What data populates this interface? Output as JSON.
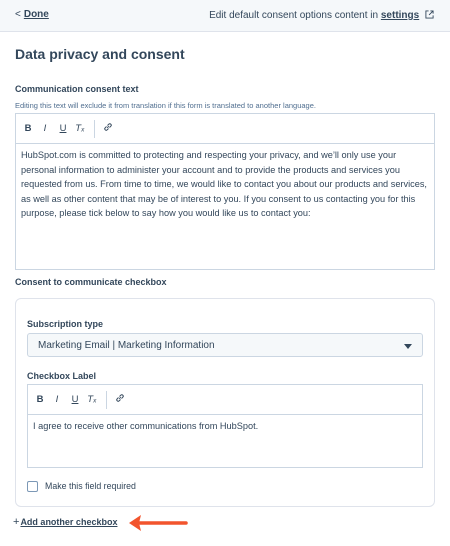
{
  "topbar": {
    "done_label": "Done",
    "edit_text": "Edit default consent options content in",
    "settings_label": "settings"
  },
  "page": {
    "title": "Data privacy and consent"
  },
  "communication": {
    "label": "Communication consent text",
    "hint": "Editing this text will exclude it from translation if this form is translated to another language.",
    "toolbar": {
      "bold": "B",
      "italic": "I",
      "underline": "U",
      "clear": "Tₓ",
      "link_icon": "link-icon"
    },
    "text": "HubSpot.com is committed to protecting and respecting your privacy, and we’ll only use your personal information to administer your account and to provide the products and services you requested from us. From time to time, we would like to contact you about our products and services, as well as other content that may be of interest to you. If you consent to us contacting you for this purpose, please tick below to say how you would like us to contact you:"
  },
  "consent_checkbox": {
    "label": "Consent to communicate checkbox",
    "subscription_label": "Subscription type",
    "subscription_value": "Marketing Email | Marketing Information",
    "checkbox_label_title": "Checkbox Label",
    "toolbar": {
      "bold": "B",
      "italic": "I",
      "underline": "U",
      "clear": "Tₓ",
      "link_icon": "link-icon"
    },
    "checkbox_text": "I agree to receive other communications from HubSpot.",
    "required_label": "Make this field required",
    "required_checked": false
  },
  "add_checkbox": {
    "plus": "+",
    "label": "Add another checkbox"
  },
  "colors": {
    "text": "#33475b",
    "border": "#cbd6e2",
    "annotation_arrow": "#f2542d"
  }
}
